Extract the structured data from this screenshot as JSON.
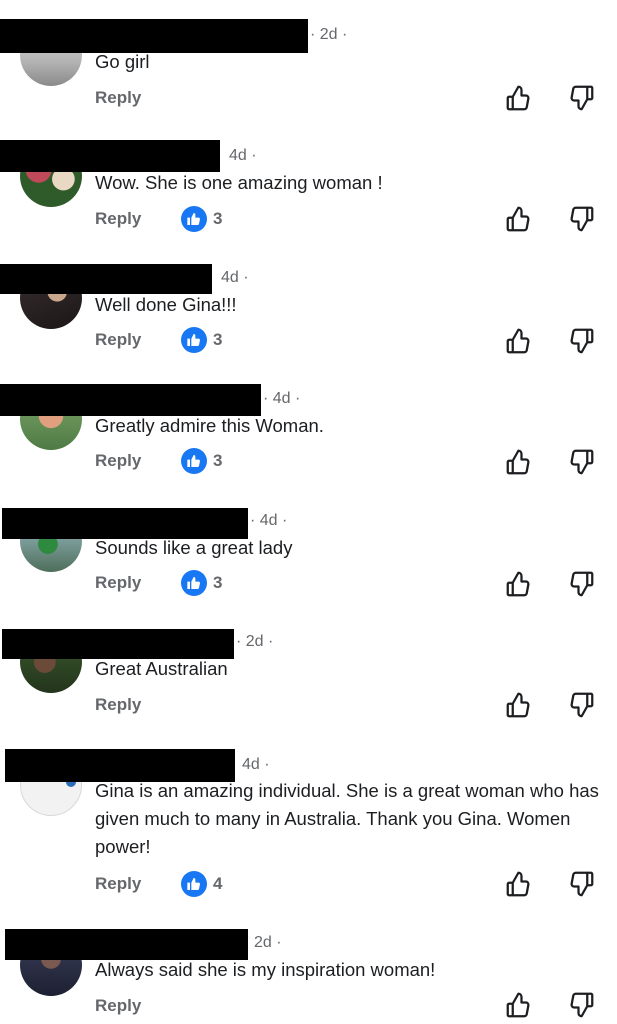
{
  "comments": [
    {
      "time": "· 2d ·",
      "text": "Go girl",
      "reply_label": "Reply",
      "likes": null
    },
    {
      "time": "4d ·",
      "text": "Wow. She is one amazing woman !",
      "reply_label": "Reply",
      "likes": "3"
    },
    {
      "time": "4d ·",
      "text": "Well done Gina!!!",
      "reply_label": "Reply",
      "likes": "3"
    },
    {
      "time": "· 4d ·",
      "text": "Greatly admire this Woman.",
      "reply_label": "Reply",
      "likes": "3"
    },
    {
      "time": "· 4d ·",
      "text": "Sounds like a great lady",
      "reply_label": "Reply",
      "likes": "3"
    },
    {
      "time": "· 2d ·",
      "text": "Great Australian",
      "reply_label": "Reply",
      "likes": null
    },
    {
      "time": "4d ·",
      "text": "Gina is an amazing individual. She is a great woman who has given much to many in Australia. Thank you Gina. Women power!",
      "reply_label": "Reply",
      "likes": "4"
    },
    {
      "time": "2d ·",
      "text": "Always said she is my inspiration woman!",
      "reply_label": "Reply",
      "likes": null
    }
  ],
  "icons": {
    "like": "thumbs-up-outline-icon",
    "dislike": "thumbs-down-outline-icon",
    "like_badge": "like-reaction-icon"
  },
  "colors": {
    "accent": "#1877f2",
    "muted_text": "#65676b",
    "text": "#1c1e21",
    "redaction": "#000000"
  }
}
